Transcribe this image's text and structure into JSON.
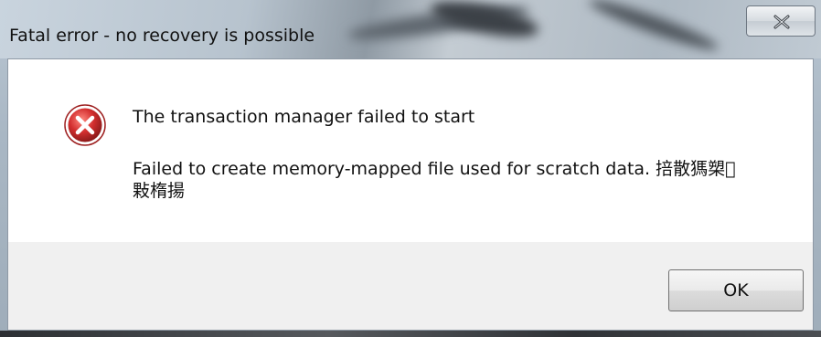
{
  "window": {
    "title": "Fatal error - no recovery is possible"
  },
  "message": {
    "heading": "The transaction manager failed to start",
    "detail": "Failed to create memory-mapped file used for scratch data. 掊散獁槊\u0000\n敤楕揚"
  },
  "buttons": {
    "ok_label": "OK"
  },
  "icons": {
    "error": "error-icon",
    "close": "close-icon"
  },
  "colors": {
    "error_red": "#c62828",
    "dialog_background": "#ffffff",
    "footer_background": "#f0f0f0"
  }
}
